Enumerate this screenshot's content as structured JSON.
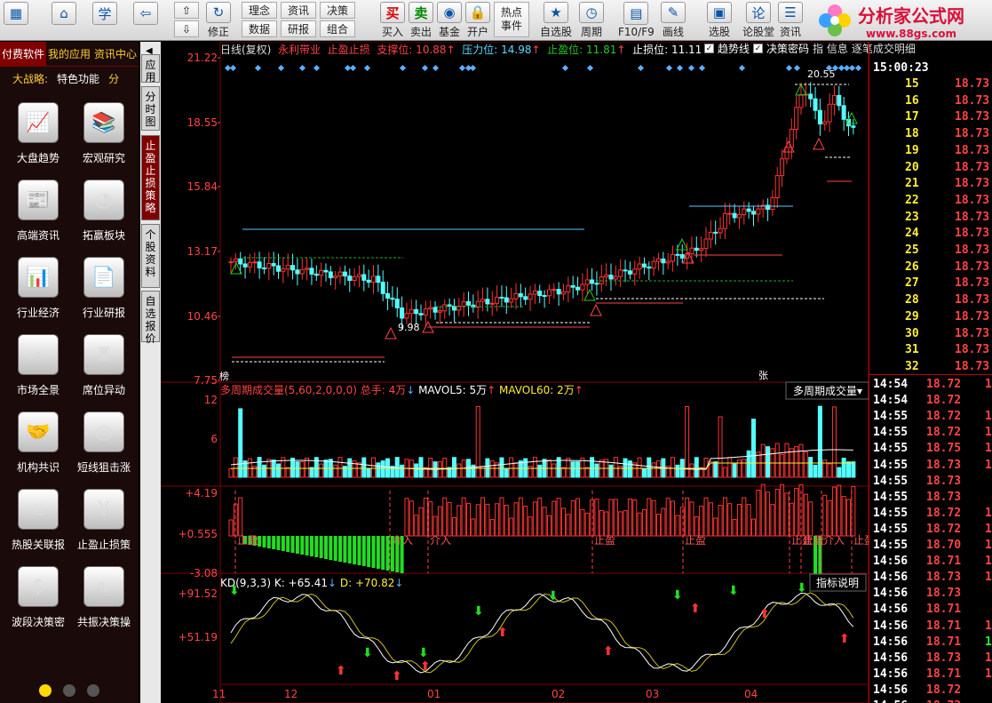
{
  "toolbar": {
    "buttons": [
      {
        "label": "",
        "icon": "grid-icon"
      },
      {
        "label": "",
        "icon": "home-icon"
      },
      {
        "label": "",
        "icon": "study-icon"
      },
      {
        "label": "",
        "icon": "back-arrow-icon"
      },
      {
        "label": "修正",
        "icon": "refresh-icon"
      },
      {
        "label": "买入",
        "icon": "buy-icon"
      },
      {
        "label": "卖出",
        "icon": "sell-icon"
      },
      {
        "label": "基金",
        "icon": "fund-icon"
      },
      {
        "label": "开户",
        "icon": "lock-icon"
      },
      {
        "label": "自选股",
        "icon": "star-icon"
      },
      {
        "label": "周期",
        "icon": "clock-icon"
      },
      {
        "label": "F10/F9",
        "icon": "f10-icon"
      },
      {
        "label": "画线",
        "icon": "pen-icon"
      },
      {
        "label": "选股",
        "icon": "screen-icon"
      },
      {
        "label": "论股堂",
        "icon": "discuss-icon"
      },
      {
        "label": "资讯",
        "icon": "news-icon"
      }
    ],
    "text_buttons": [
      "理念",
      "资讯",
      "决策",
      "数据",
      "研报",
      "组合"
    ],
    "buy_glyph": "买",
    "sell_glyph": "卖",
    "hot_events": "热点\n事件"
  },
  "logo": {
    "name": "分析家公式网",
    "url": "www.88gs.com"
  },
  "sidebar": {
    "tabs": [
      "付费软件",
      "我的应用",
      "资讯中心"
    ],
    "strategy_label": "大战略:",
    "strategy_value": "特色功能",
    "strategy_more": "分",
    "items": [
      {
        "label": "大盘趋势",
        "icon": "trend-chart-icon"
      },
      {
        "label": "宏观研究",
        "icon": "books-icon"
      },
      {
        "label": "高端资讯",
        "icon": "newspaper-icon"
      },
      {
        "label": "拓赢板块",
        "icon": "pie-chart-icon"
      },
      {
        "label": "行业经济",
        "icon": "bar-chart-icon"
      },
      {
        "label": "行业研报",
        "icon": "report-icon"
      },
      {
        "label": "市场全景",
        "icon": "market-chart-icon"
      },
      {
        "label": "席位异动",
        "icon": "seat-icon"
      },
      {
        "label": "机构共识",
        "icon": "handshake-icon"
      },
      {
        "label": "短线狙击涨",
        "icon": "target-icon"
      },
      {
        "label": "热股关联报",
        "icon": "hot-stock-icon"
      },
      {
        "label": "止盈止损策",
        "icon": "money-cage-icon"
      },
      {
        "label": "波段决策密",
        "icon": "wave-icon"
      },
      {
        "label": "共振决策操",
        "icon": "resonance-icon"
      }
    ]
  },
  "vtabs": [
    "应用",
    "分时图",
    "止盈止损策略",
    "个股资料",
    "自选报价"
  ],
  "chart": {
    "header": {
      "name": "日线(复权)",
      "ind": "永利带业",
      "ind2": "止盈止损",
      "support": "支撑位: 10.88",
      "pressure": "压力位: 14.98",
      "tp": "止盈位: 11.81",
      "sl": "止损位: 11.11",
      "chk1": "趋势线",
      "chk2": "决策密码",
      "extra": "指 信息",
      "title_right": "逐笔成交明细"
    },
    "price_axis": [
      "21.22",
      "18.55",
      "15.84",
      "13.17",
      "10.46",
      "7.75"
    ],
    "low_label": "9.98",
    "high_label": "20.55",
    "vol_header": {
      "name": "多周期成交量(5,60,2,0,0,0)",
      "total": "总手: 4万",
      "ma5": "MAVOL5: 5万",
      "ma60": "MAVOL60: 2万",
      "button": "多周期成交量"
    },
    "vol_axis": [
      "12",
      "6"
    ],
    "stop_axis": [
      "+4.19",
      "+0.555",
      "-3.08"
    ],
    "stop_tags": [
      "止盈",
      "介入",
      "介入",
      "止盈",
      "止盈",
      "止盈",
      "止盈",
      "介入",
      "止盈"
    ],
    "kd_header": {
      "name": "KD(9,3,3)",
      "k": "K: +65.41",
      "d": "D: +70.82",
      "button": "指标说明"
    },
    "kd_axis": [
      "+91.52",
      "+51.19"
    ],
    "months": [
      "11",
      "12",
      "01",
      "02",
      "03",
      "04"
    ],
    "tag_bang": "榜",
    "tag_zhang": "张",
    "colors": {
      "up": "#ff3333",
      "down": "#54ffff",
      "ma": "#ffffff",
      "grid": "#800000",
      "green": "#22dd22"
    }
  },
  "chart_data": {
    "type": "candlestick",
    "y_axis_ticks": [
      "21.22",
      "18.55",
      "15.84",
      "13.17",
      "10.46",
      "7.75"
    ],
    "ylim": [
      7.75,
      21.22
    ],
    "x_month_labels": [
      "11",
      "12",
      "01",
      "02",
      "03",
      "04"
    ],
    "lines": {
      "support": 10.88,
      "pressure": 14.98,
      "take_profit": 11.81,
      "stop_loss": 11.11
    },
    "annotations": {
      "low": "9.98",
      "high": "20.55"
    }
  },
  "ticks": {
    "time": "15:00:23",
    "top_rows": [
      {
        "n": "15",
        "p": "18.73"
      },
      {
        "n": "16",
        "p": "18.73"
      },
      {
        "n": "17",
        "p": "18.73"
      },
      {
        "n": "18",
        "p": "18.73"
      },
      {
        "n": "19",
        "p": "18.73"
      },
      {
        "n": "20",
        "p": "18.73"
      },
      {
        "n": "21",
        "p": "18.73"
      },
      {
        "n": "22",
        "p": "18.73"
      },
      {
        "n": "23",
        "p": "18.73"
      },
      {
        "n": "24",
        "p": "18.73"
      },
      {
        "n": "25",
        "p": "18.73"
      },
      {
        "n": "26",
        "p": "18.73"
      },
      {
        "n": "27",
        "p": "18.73"
      },
      {
        "n": "28",
        "p": "18.73"
      },
      {
        "n": "29",
        "p": "18.73"
      },
      {
        "n": "30",
        "p": "18.73"
      },
      {
        "n": "31",
        "p": "18.73"
      },
      {
        "n": "32",
        "p": "18.73"
      }
    ],
    "rows": [
      {
        "t": "14:54",
        "p": "18.72",
        "v": "1"
      },
      {
        "t": "14:54",
        "p": "18.72",
        "v": ""
      },
      {
        "t": "14:55",
        "p": "18.72",
        "v": "1"
      },
      {
        "t": "14:55",
        "p": "18.72",
        "v": "1"
      },
      {
        "t": "14:55",
        "p": "18.75",
        "v": "10"
      },
      {
        "t": "14:55",
        "p": "18.73",
        "v": "1"
      },
      {
        "t": "14:55",
        "p": "18.73",
        "v": ""
      },
      {
        "t": "14:55",
        "p": "18.73",
        "v": ""
      },
      {
        "t": "14:55",
        "p": "18.72",
        "v": "1"
      },
      {
        "t": "14:55",
        "p": "18.72",
        "v": "1"
      },
      {
        "t": "14:55",
        "p": "18.70",
        "v": "1"
      },
      {
        "t": "14:56",
        "p": "18.71",
        "v": "1"
      },
      {
        "t": "14:56",
        "p": "18.73",
        "v": "1"
      },
      {
        "t": "14:56",
        "p": "18.73",
        "v": ""
      },
      {
        "t": "14:56",
        "p": "18.71",
        "v": ""
      },
      {
        "t": "14:56",
        "p": "18.71",
        "v": "1"
      },
      {
        "t": "14:56",
        "p": "18.71",
        "v": "11"
      },
      {
        "t": "14:56",
        "p": "18.73",
        "v": "1"
      },
      {
        "t": "14:56",
        "p": "18.71",
        "v": "1"
      },
      {
        "t": "14:56",
        "p": "18.72",
        "v": ""
      },
      {
        "t": "14:56",
        "p": "18.72",
        "v": ""
      }
    ]
  }
}
